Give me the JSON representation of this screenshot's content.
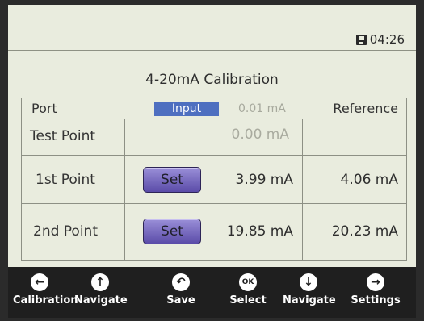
{
  "status": {
    "time": "04:26"
  },
  "title": "4-20mA Calibration",
  "header": {
    "port_label": "Port",
    "input_label": "Input",
    "input_reading": "0.01 mA",
    "reference_label": "Reference"
  },
  "rows": [
    {
      "label": "Test Point",
      "measured": "0.00 mA",
      "reference": "",
      "button": ""
    },
    {
      "label": "1st Point",
      "measured": "3.99 mA",
      "reference": "4.06 mA",
      "button": "Set"
    },
    {
      "label": "2nd Point",
      "measured": "19.85 mA",
      "reference": "20.23 mA",
      "button": "Set"
    }
  ],
  "footer": [
    {
      "label": "Calibration",
      "icon": "arrow-left-icon"
    },
    {
      "label": "Navigate",
      "icon": "arrow-up-icon"
    },
    {
      "label": "Save",
      "icon": "undo-icon"
    },
    {
      "label": "Select",
      "icon": "ok-icon"
    },
    {
      "label": "Navigate",
      "icon": "arrow-down-icon"
    },
    {
      "label": "Settings",
      "icon": "arrow-right-icon"
    }
  ]
}
